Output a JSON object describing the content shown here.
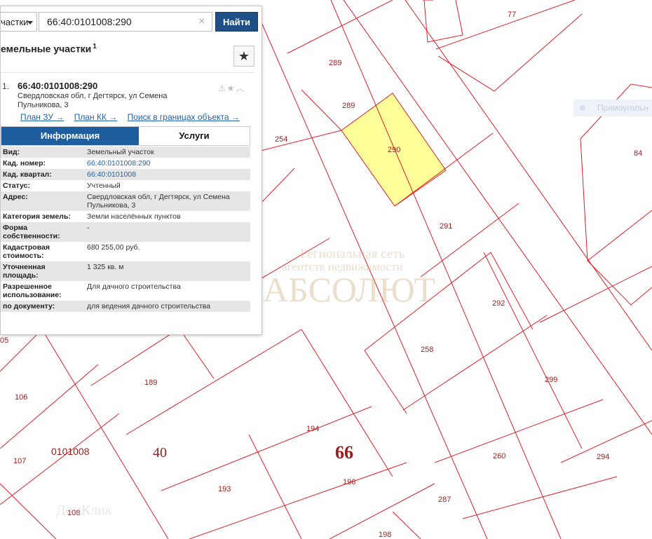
{
  "search": {
    "category": "частки",
    "value": "66:40:0101008:290",
    "button": "Найти"
  },
  "results": {
    "title": "емельные участки",
    "count": "1"
  },
  "item": {
    "index": "1.",
    "id": "66:40:0101008:290",
    "address": "Свердловская обл, г Дегтярск, ул Семена Пульникова, 3",
    "links": [
      "План ЗУ →",
      "План КК →",
      "Поиск в границах объекта →"
    ]
  },
  "tabs": {
    "info": "Информация",
    "services": "Услуги"
  },
  "info_rows": [
    {
      "key": "Вид:",
      "value": "Земельный участок"
    },
    {
      "key": "Кад. номер:",
      "value": "66:40:0101008:290"
    },
    {
      "key": "Кад. квартал:",
      "value": "66:40:0101008"
    },
    {
      "key": "Статус:",
      "value": "Учтенный"
    },
    {
      "key": "Адрес:",
      "value": "Свердловская обл, г Дегтярск, ул Семена Пульникова, 3"
    },
    {
      "key": "Категория земель:",
      "value": "Земли населённых пунктов"
    },
    {
      "key": "Форма собственности:",
      "value": "-"
    },
    {
      "key": "Кадастровая стоимость:",
      "value": "680 255,00 руб."
    },
    {
      "key": "Уточненная площадь:",
      "value": "1 325 кв. м"
    },
    {
      "key": "Разрешенное использование:",
      "value": "Для дачного строительства"
    },
    {
      "key": "по документу:",
      "value": "для ведения дачного строительства"
    }
  ],
  "map": {
    "plots": {
      "p77": "77",
      "p289a": "289",
      "p289b": "289",
      "p290": "290",
      "p254": "254",
      "p84": "84",
      "p291": "291",
      "p292": "292",
      "p258": "258",
      "p299": "299",
      "p189": "189",
      "p106": "106",
      "p194": "194",
      "p107": "107",
      "p193": "193",
      "p196": "196",
      "p260": "260",
      "p294": "294",
      "p287": "287",
      "p108": "108",
      "p198": "198",
      "p05": "05"
    },
    "quarter": "0101008",
    "district": "40",
    "region": "66",
    "legend_fragment": "Прямоугольн"
  },
  "watermark": {
    "line1": "Региональная сеть",
    "line2": "агентств недвижимости",
    "brand": "АБСОЛЮТ",
    "domclick": "ДомКлик"
  },
  "colors": {
    "selected_fill": "#ffff99",
    "boundary": "#e0202a",
    "accent": "#1e4f86"
  }
}
